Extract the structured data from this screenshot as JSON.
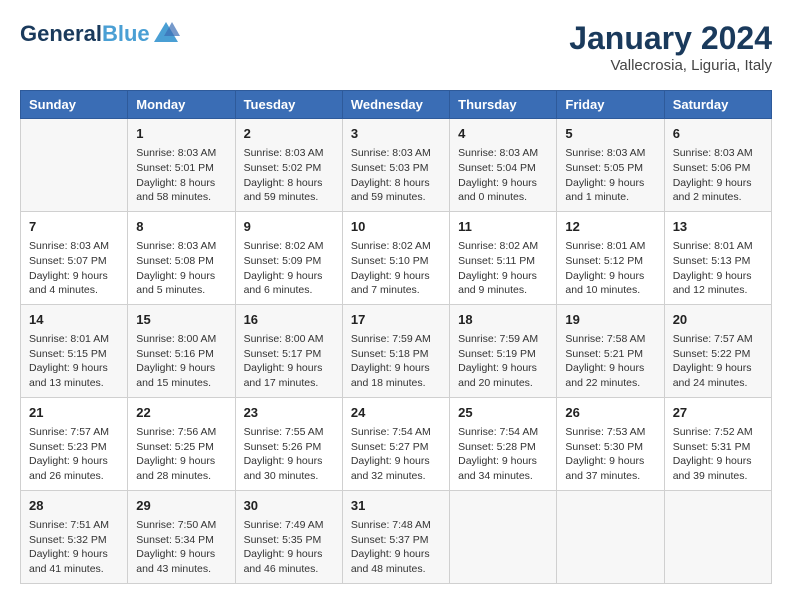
{
  "header": {
    "logo_line1": "General",
    "logo_line2": "Blue",
    "month": "January 2024",
    "location": "Vallecrosia, Liguria, Italy"
  },
  "weekdays": [
    "Sunday",
    "Monday",
    "Tuesday",
    "Wednesday",
    "Thursday",
    "Friday",
    "Saturday"
  ],
  "weeks": [
    [
      {
        "day": "",
        "sunrise": "",
        "sunset": "",
        "daylight": ""
      },
      {
        "day": "1",
        "sunrise": "Sunrise: 8:03 AM",
        "sunset": "Sunset: 5:01 PM",
        "daylight": "Daylight: 8 hours and 58 minutes."
      },
      {
        "day": "2",
        "sunrise": "Sunrise: 8:03 AM",
        "sunset": "Sunset: 5:02 PM",
        "daylight": "Daylight: 8 hours and 59 minutes."
      },
      {
        "day": "3",
        "sunrise": "Sunrise: 8:03 AM",
        "sunset": "Sunset: 5:03 PM",
        "daylight": "Daylight: 8 hours and 59 minutes."
      },
      {
        "day": "4",
        "sunrise": "Sunrise: 8:03 AM",
        "sunset": "Sunset: 5:04 PM",
        "daylight": "Daylight: 9 hours and 0 minutes."
      },
      {
        "day": "5",
        "sunrise": "Sunrise: 8:03 AM",
        "sunset": "Sunset: 5:05 PM",
        "daylight": "Daylight: 9 hours and 1 minute."
      },
      {
        "day": "6",
        "sunrise": "Sunrise: 8:03 AM",
        "sunset": "Sunset: 5:06 PM",
        "daylight": "Daylight: 9 hours and 2 minutes."
      }
    ],
    [
      {
        "day": "7",
        "sunrise": "Sunrise: 8:03 AM",
        "sunset": "Sunset: 5:07 PM",
        "daylight": "Daylight: 9 hours and 4 minutes."
      },
      {
        "day": "8",
        "sunrise": "Sunrise: 8:03 AM",
        "sunset": "Sunset: 5:08 PM",
        "daylight": "Daylight: 9 hours and 5 minutes."
      },
      {
        "day": "9",
        "sunrise": "Sunrise: 8:02 AM",
        "sunset": "Sunset: 5:09 PM",
        "daylight": "Daylight: 9 hours and 6 minutes."
      },
      {
        "day": "10",
        "sunrise": "Sunrise: 8:02 AM",
        "sunset": "Sunset: 5:10 PM",
        "daylight": "Daylight: 9 hours and 7 minutes."
      },
      {
        "day": "11",
        "sunrise": "Sunrise: 8:02 AM",
        "sunset": "Sunset: 5:11 PM",
        "daylight": "Daylight: 9 hours and 9 minutes."
      },
      {
        "day": "12",
        "sunrise": "Sunrise: 8:01 AM",
        "sunset": "Sunset: 5:12 PM",
        "daylight": "Daylight: 9 hours and 10 minutes."
      },
      {
        "day": "13",
        "sunrise": "Sunrise: 8:01 AM",
        "sunset": "Sunset: 5:13 PM",
        "daylight": "Daylight: 9 hours and 12 minutes."
      }
    ],
    [
      {
        "day": "14",
        "sunrise": "Sunrise: 8:01 AM",
        "sunset": "Sunset: 5:15 PM",
        "daylight": "Daylight: 9 hours and 13 minutes."
      },
      {
        "day": "15",
        "sunrise": "Sunrise: 8:00 AM",
        "sunset": "Sunset: 5:16 PM",
        "daylight": "Daylight: 9 hours and 15 minutes."
      },
      {
        "day": "16",
        "sunrise": "Sunrise: 8:00 AM",
        "sunset": "Sunset: 5:17 PM",
        "daylight": "Daylight: 9 hours and 17 minutes."
      },
      {
        "day": "17",
        "sunrise": "Sunrise: 7:59 AM",
        "sunset": "Sunset: 5:18 PM",
        "daylight": "Daylight: 9 hours and 18 minutes."
      },
      {
        "day": "18",
        "sunrise": "Sunrise: 7:59 AM",
        "sunset": "Sunset: 5:19 PM",
        "daylight": "Daylight: 9 hours and 20 minutes."
      },
      {
        "day": "19",
        "sunrise": "Sunrise: 7:58 AM",
        "sunset": "Sunset: 5:21 PM",
        "daylight": "Daylight: 9 hours and 22 minutes."
      },
      {
        "day": "20",
        "sunrise": "Sunrise: 7:57 AM",
        "sunset": "Sunset: 5:22 PM",
        "daylight": "Daylight: 9 hours and 24 minutes."
      }
    ],
    [
      {
        "day": "21",
        "sunrise": "Sunrise: 7:57 AM",
        "sunset": "Sunset: 5:23 PM",
        "daylight": "Daylight: 9 hours and 26 minutes."
      },
      {
        "day": "22",
        "sunrise": "Sunrise: 7:56 AM",
        "sunset": "Sunset: 5:25 PM",
        "daylight": "Daylight: 9 hours and 28 minutes."
      },
      {
        "day": "23",
        "sunrise": "Sunrise: 7:55 AM",
        "sunset": "Sunset: 5:26 PM",
        "daylight": "Daylight: 9 hours and 30 minutes."
      },
      {
        "day": "24",
        "sunrise": "Sunrise: 7:54 AM",
        "sunset": "Sunset: 5:27 PM",
        "daylight": "Daylight: 9 hours and 32 minutes."
      },
      {
        "day": "25",
        "sunrise": "Sunrise: 7:54 AM",
        "sunset": "Sunset: 5:28 PM",
        "daylight": "Daylight: 9 hours and 34 minutes."
      },
      {
        "day": "26",
        "sunrise": "Sunrise: 7:53 AM",
        "sunset": "Sunset: 5:30 PM",
        "daylight": "Daylight: 9 hours and 37 minutes."
      },
      {
        "day": "27",
        "sunrise": "Sunrise: 7:52 AM",
        "sunset": "Sunset: 5:31 PM",
        "daylight": "Daylight: 9 hours and 39 minutes."
      }
    ],
    [
      {
        "day": "28",
        "sunrise": "Sunrise: 7:51 AM",
        "sunset": "Sunset: 5:32 PM",
        "daylight": "Daylight: 9 hours and 41 minutes."
      },
      {
        "day": "29",
        "sunrise": "Sunrise: 7:50 AM",
        "sunset": "Sunset: 5:34 PM",
        "daylight": "Daylight: 9 hours and 43 minutes."
      },
      {
        "day": "30",
        "sunrise": "Sunrise: 7:49 AM",
        "sunset": "Sunset: 5:35 PM",
        "daylight": "Daylight: 9 hours and 46 minutes."
      },
      {
        "day": "31",
        "sunrise": "Sunrise: 7:48 AM",
        "sunset": "Sunset: 5:37 PM",
        "daylight": "Daylight: 9 hours and 48 minutes."
      },
      {
        "day": "",
        "sunrise": "",
        "sunset": "",
        "daylight": ""
      },
      {
        "day": "",
        "sunrise": "",
        "sunset": "",
        "daylight": ""
      },
      {
        "day": "",
        "sunrise": "",
        "sunset": "",
        "daylight": ""
      }
    ]
  ]
}
